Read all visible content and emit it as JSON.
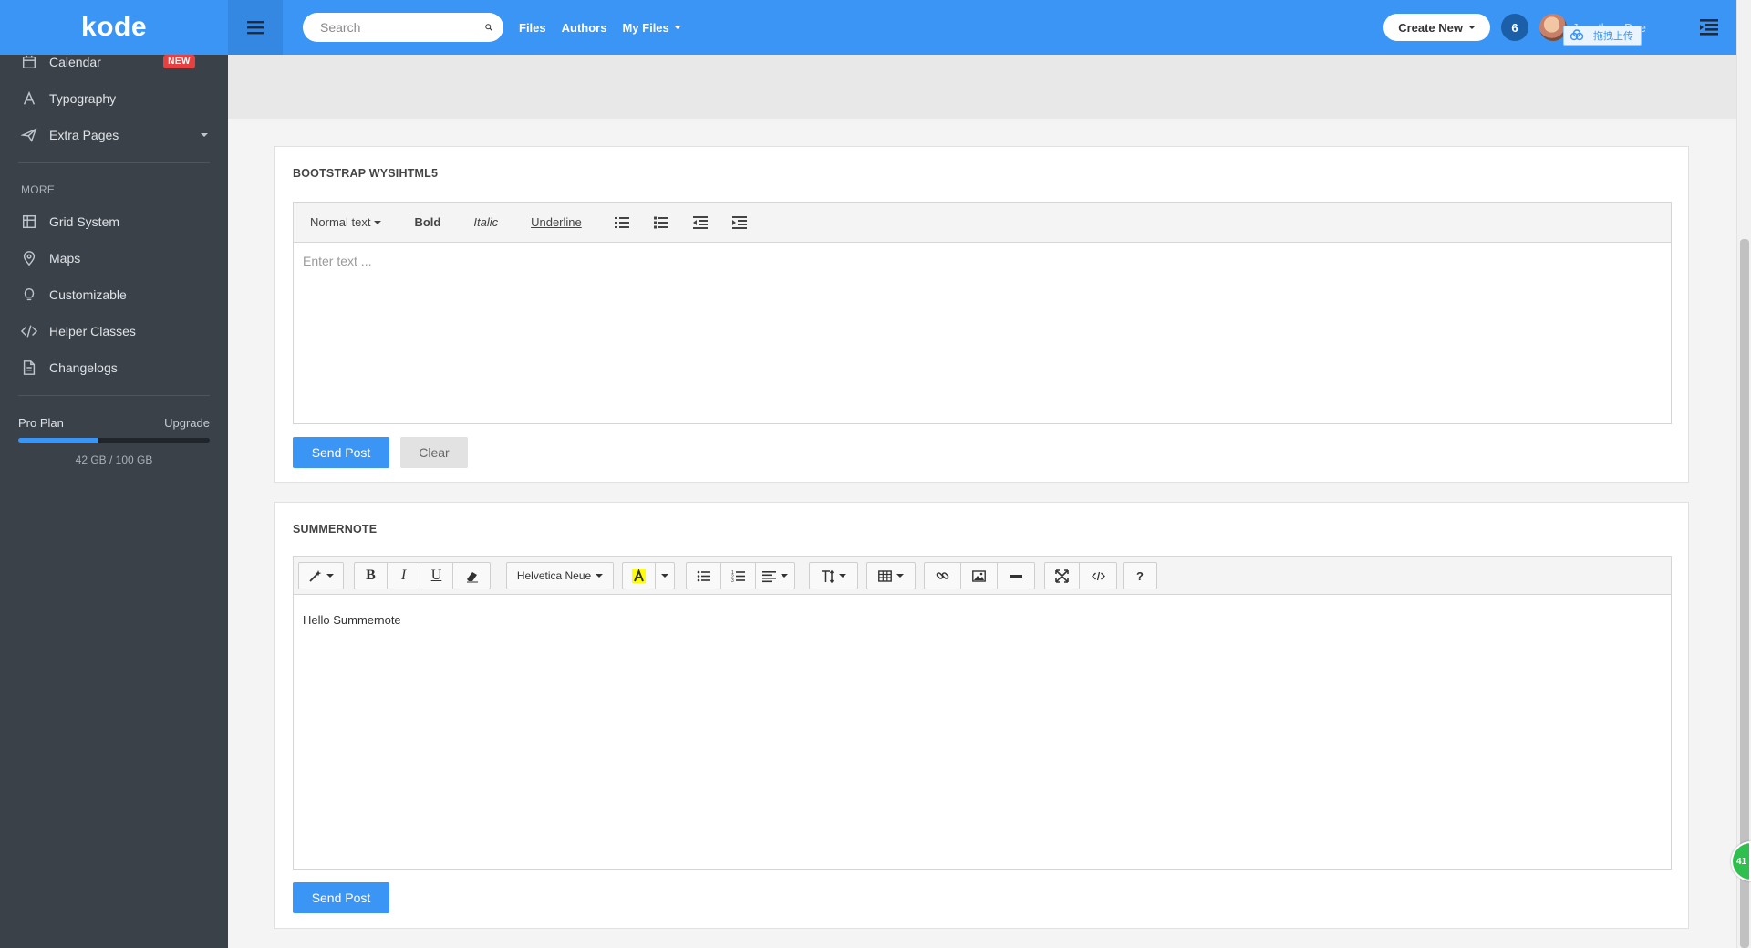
{
  "brand": {
    "name": "kode"
  },
  "sidebar": {
    "items": [
      {
        "label": "Calendar",
        "badge": "NEW",
        "icon": "calendar-icon"
      },
      {
        "label": "Typography",
        "icon": "typography-icon"
      },
      {
        "label": "Extra Pages",
        "icon": "paper-plane-icon"
      }
    ],
    "more_label": "MORE",
    "more_items": [
      {
        "label": "Grid System",
        "icon": "grid-icon"
      },
      {
        "label": "Maps",
        "icon": "map-pin-icon"
      },
      {
        "label": "Customizable",
        "icon": "lightbulb-icon"
      },
      {
        "label": "Helper Classes",
        "icon": "code-icon"
      },
      {
        "label": "Changelogs",
        "icon": "document-icon"
      }
    ],
    "plan": {
      "name": "Pro Plan",
      "upgrade": "Upgrade",
      "used_fraction": 0.42,
      "usage": "42 GB / 100 GB"
    }
  },
  "topbar": {
    "search_placeholder": "Search",
    "links": [
      "Files",
      "Authors",
      "My Files"
    ],
    "create_label": "Create New",
    "notifications": "6",
    "user_name": "Jonathan Doe",
    "upload_label": "拖拽上传"
  },
  "wysihtml5": {
    "title": "BOOTSTRAP WYSIHTML5",
    "toolbar": {
      "format": "Normal text",
      "bold": "Bold",
      "italic": "Italic",
      "underline": "Underline"
    },
    "placeholder": "Enter text ...",
    "send_label": "Send Post",
    "clear_label": "Clear"
  },
  "summernote": {
    "title": "SUMMERNOTE",
    "font_name": "Helvetica Neue",
    "content": "Hello Summernote",
    "send_label": "Send Post",
    "highlight_color": "#ffff00"
  },
  "fab_label": "41",
  "colors": {
    "accent": "#3b95f5",
    "sidebar": "#3a4149",
    "badge": "#e64141"
  }
}
